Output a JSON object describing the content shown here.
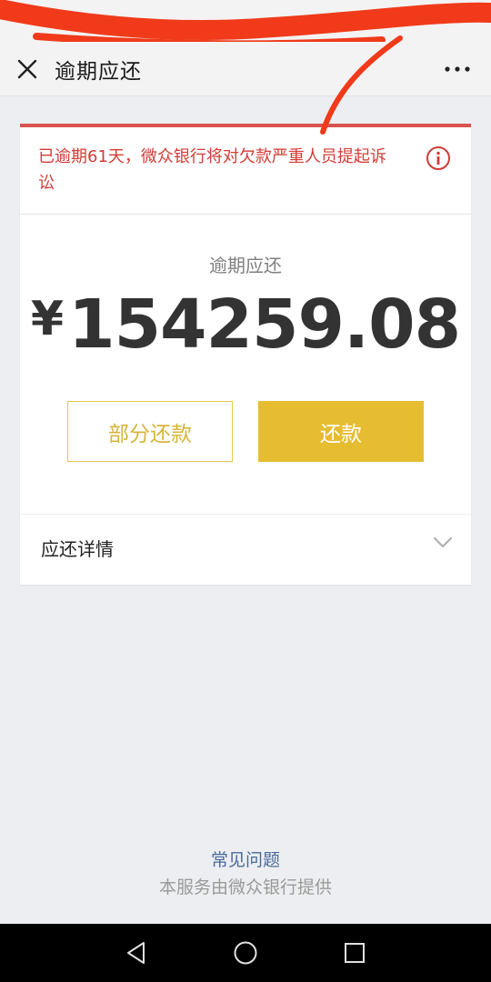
{
  "colors": {
    "alert_red": "#d23c36",
    "gold": "#e6bd30",
    "gold_text": "#d6b53c",
    "link_blue": "#4a6a99",
    "scribble_red": "#f03a1a"
  },
  "nav": {
    "close_icon": "close-icon",
    "title": "逾期应还",
    "more_icon": "more-dots-icon"
  },
  "alert": {
    "text": "已逾期61天，微众银行将对欠款严重人员提起诉讼",
    "icon": "info-icon"
  },
  "amount": {
    "label": "逾期应还",
    "currency": "¥",
    "value": "154259.08"
  },
  "buttons": {
    "partial_label": "部分还款",
    "repay_label": "还款"
  },
  "details": {
    "label": "应还详情",
    "icon": "chevron-down-icon"
  },
  "footer": {
    "faq": "常见问题",
    "provider": "本服务由微众银行提供"
  },
  "system_nav": {
    "back_icon": "back-triangle-icon",
    "home_icon": "home-circle-icon",
    "recents_icon": "recents-square-icon"
  }
}
